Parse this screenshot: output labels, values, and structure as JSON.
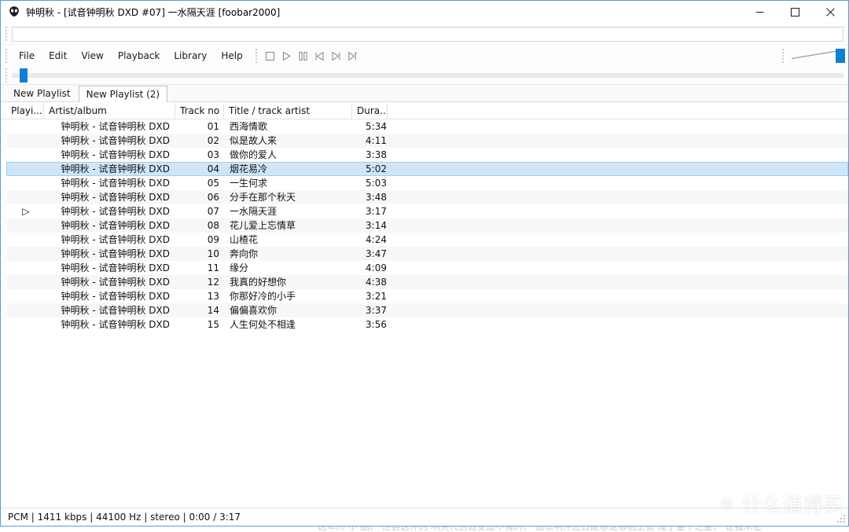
{
  "window": {
    "title": "钟明秋 - [试音钟明秋 DXD #07] 一水隔天涯  [foobar2000]",
    "app_icon": "foobar2000-alien-icon",
    "minimize_label": "─",
    "maximize_label": "□",
    "close_label": "✕",
    "accent_color": "#4aa3e0"
  },
  "toolbar": {
    "search_value": "",
    "search_placeholder": ""
  },
  "menu": {
    "items": [
      {
        "label": "File"
      },
      {
        "label": "Edit"
      },
      {
        "label": "View"
      },
      {
        "label": "Playback"
      },
      {
        "label": "Library"
      },
      {
        "label": "Help"
      }
    ]
  },
  "transport": {
    "buttons": [
      {
        "name": "stop-button",
        "icon": "stop-icon"
      },
      {
        "name": "play-button",
        "icon": "play-icon"
      },
      {
        "name": "pause-button",
        "icon": "pause-icon"
      },
      {
        "name": "previous-button",
        "icon": "previous-track-icon"
      },
      {
        "name": "next-button",
        "icon": "next-track-icon"
      },
      {
        "name": "random-button",
        "icon": "random-track-icon"
      }
    ]
  },
  "seek": {
    "position_percent": 0
  },
  "volume": {
    "level_percent": 100
  },
  "playlist_tabs": [
    {
      "label": "New Playlist",
      "active": false
    },
    {
      "label": "New Playlist (2)",
      "active": true
    }
  ],
  "columns": {
    "playing": "Playi...",
    "artist": "Artist/album",
    "trackno": "Track no",
    "title": "Title / track artist",
    "duration": "Dura..."
  },
  "tracks": [
    {
      "playing": "",
      "artist": "钟明秋 - 试音钟明秋 DXD",
      "trackno": "01",
      "title": "西海情歌",
      "duration": "5:34",
      "selected": false
    },
    {
      "playing": "",
      "artist": "钟明秋 - 试音钟明秋 DXD",
      "trackno": "02",
      "title": "似是故人来",
      "duration": "4:11",
      "selected": false
    },
    {
      "playing": "",
      "artist": "钟明秋 - 试音钟明秋 DXD",
      "trackno": "03",
      "title": "做你的爱人",
      "duration": "3:38",
      "selected": false
    },
    {
      "playing": "",
      "artist": "钟明秋 - 试音钟明秋 DXD",
      "trackno": "04",
      "title": "烟花易冷",
      "duration": "5:02",
      "selected": true
    },
    {
      "playing": "",
      "artist": "钟明秋 - 试音钟明秋 DXD",
      "trackno": "05",
      "title": "一生何求",
      "duration": "5:03",
      "selected": false
    },
    {
      "playing": "",
      "artist": "钟明秋 - 试音钟明秋 DXD",
      "trackno": "06",
      "title": "分手在那个秋天",
      "duration": "3:48",
      "selected": false
    },
    {
      "playing": "▷",
      "artist": "钟明秋 - 试音钟明秋 DXD",
      "trackno": "07",
      "title": "一水隔天涯",
      "duration": "3:17",
      "selected": false
    },
    {
      "playing": "",
      "artist": "钟明秋 - 试音钟明秋 DXD",
      "trackno": "08",
      "title": "花儿爱上忘情草",
      "duration": "3:14",
      "selected": false
    },
    {
      "playing": "",
      "artist": "钟明秋 - 试音钟明秋 DXD",
      "trackno": "09",
      "title": "山楂花",
      "duration": "4:24",
      "selected": false
    },
    {
      "playing": "",
      "artist": "钟明秋 - 试音钟明秋 DXD",
      "trackno": "10",
      "title": "奔向你",
      "duration": "3:47",
      "selected": false
    },
    {
      "playing": "",
      "artist": "钟明秋 - 试音钟明秋 DXD",
      "trackno": "11",
      "title": "缘分",
      "duration": "4:09",
      "selected": false
    },
    {
      "playing": "",
      "artist": "钟明秋 - 试音钟明秋 DXD",
      "trackno": "12",
      "title": "我真的好想你",
      "duration": "4:38",
      "selected": false
    },
    {
      "playing": "",
      "artist": "钟明秋 - 试音钟明秋 DXD",
      "trackno": "13",
      "title": "你那好冷的小手",
      "duration": "3:21",
      "selected": false
    },
    {
      "playing": "",
      "artist": "钟明秋 - 试音钟明秋 DXD",
      "trackno": "14",
      "title": "偏偏喜欢你",
      "duration": "3:37",
      "selected": false
    },
    {
      "playing": "",
      "artist": "钟明秋 - 试音钟明秋 DXD",
      "trackno": "15",
      "title": "人生何处不相逢",
      "duration": "3:56",
      "selected": false
    }
  ],
  "statusbar": {
    "text": "PCM | 1411 kbps | 44100 Hz | stereo | 0:00 / 3:17"
  },
  "watermark": {
    "mark": "值",
    "text": "什么值得买"
  },
  "background": {
    "clipped_text": "这年川 小 品。 他县这件的 明关代创造受迫不悔的， 加以明件还日能够走够相工管 成了董十之董。 让我从密"
  }
}
